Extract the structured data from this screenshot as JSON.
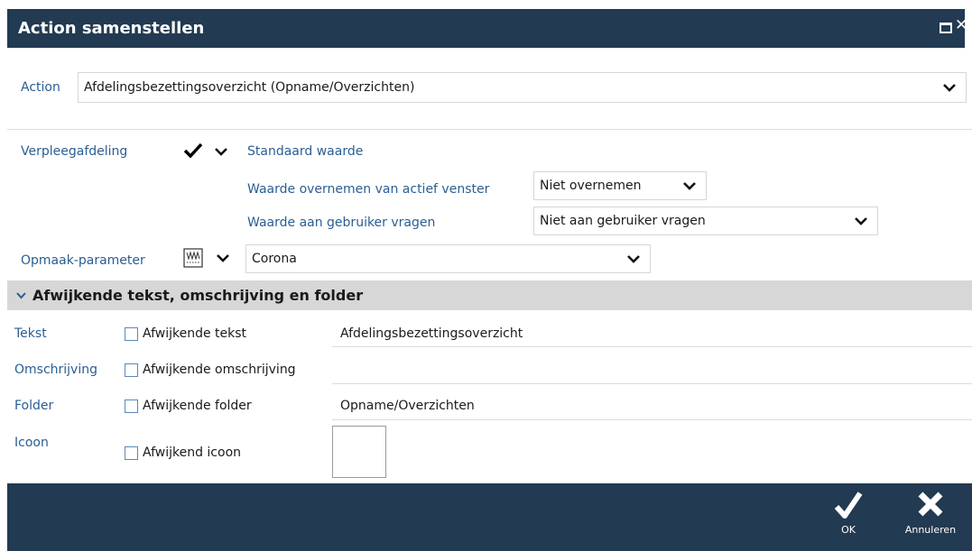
{
  "window": {
    "title": "Action samenstellen"
  },
  "action": {
    "label": "Action",
    "value": "Afdelingsbezettingsoverzicht (Opname/Overzichten)"
  },
  "verpleeg": {
    "label": "Verpleegafdeling",
    "standaard_label": "Standaard waarde",
    "overnemen_label": "Waarde overnemen van actief venster",
    "overnemen_value": "Niet overnemen",
    "vragen_label": "Waarde aan gebruiker vragen",
    "vragen_value": "Niet aan gebruiker vragen"
  },
  "opmaak": {
    "label": "Opmaak-parameter",
    "value": "Corona"
  },
  "section": {
    "title": "Afwijkende tekst, omschrijving en folder"
  },
  "rows": {
    "tekst": {
      "label": "Tekst",
      "checkbox": "Afwijkende tekst",
      "value": "Afdelingsbezettingsoverzicht"
    },
    "omschrijving": {
      "label": "Omschrijving",
      "checkbox": "Afwijkende omschrijving",
      "value": ""
    },
    "folder": {
      "label": "Folder",
      "checkbox": "Afwijkende folder",
      "value": "Opname/Overzichten"
    },
    "icoon": {
      "label": "Icoon",
      "checkbox": "Afwijkend icoon"
    }
  },
  "footer": {
    "ok_label": "OK",
    "cancel_label": "Annuleren"
  },
  "colors": {
    "header_bg": "#223a52",
    "label_blue": "#2a5e93",
    "section_bg": "#d7d7d7"
  },
  "icons": [
    "maximize-icon",
    "close-icon",
    "checkmark-icon",
    "chevron-down-icon",
    "parameter-grid-icon",
    "ok-check-icon",
    "cancel-x-icon"
  ]
}
